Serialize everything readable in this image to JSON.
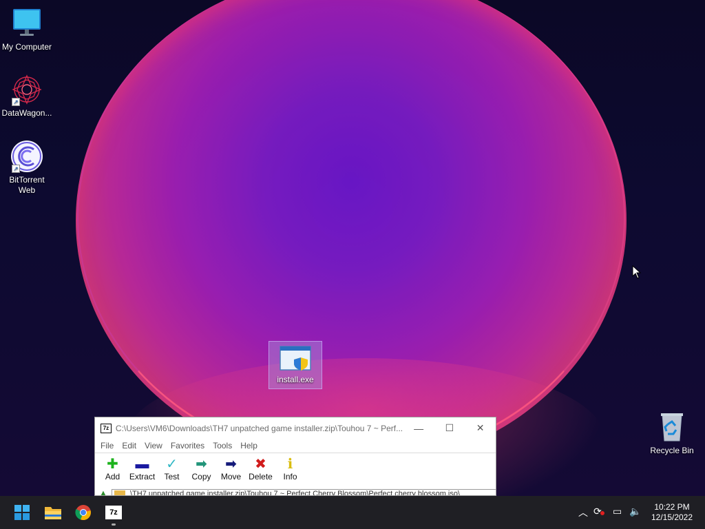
{
  "desktop": {
    "icons": [
      {
        "label": "My Computer",
        "icon": "monitor-icon"
      },
      {
        "label": "DataWagon...",
        "icon": "datawagon-icon"
      },
      {
        "label": "BitTorrent Web",
        "icon": "bittorrent-icon"
      },
      {
        "label": "install.exe",
        "icon": "installer-exe-icon"
      },
      {
        "label": "Recycle Bin",
        "icon": "recycle-bin-icon"
      }
    ]
  },
  "zip_window": {
    "app_icon_text": "7z",
    "title": "C:\\Users\\VM6\\Downloads\\TH7 unpatched game installer.zip\\Touhou 7 ~ Perf...",
    "menu": [
      "File",
      "Edit",
      "View",
      "Favorites",
      "Tools",
      "Help"
    ],
    "toolbar": [
      {
        "label": "Add",
        "icon": "plus-icon",
        "color": "#1db31d"
      },
      {
        "label": "Extract",
        "icon": "minus-icon",
        "color": "#1a1aa0"
      },
      {
        "label": "Test",
        "icon": "check-icon",
        "color": "#2fb7c4"
      },
      {
        "label": "Copy",
        "icon": "copy-arrow-icon",
        "color": "#23957a"
      },
      {
        "label": "Move",
        "icon": "move-arrow-icon",
        "color": "#151b7a"
      },
      {
        "label": "Delete",
        "icon": "delete-x-icon",
        "color": "#d11c1c"
      },
      {
        "label": "Info",
        "icon": "info-icon",
        "color": "#e0c419"
      }
    ],
    "address": "\\TH7 unpatched game installer.zip\\Touhou 7 ~ Perfect Cherry Blossom\\Perfect cherry blossom.iso\\"
  },
  "taskbar": {
    "time": "10:22 PM",
    "date": "12/15/2022",
    "zip_label": "7z"
  },
  "colors": {
    "accent": "#0078d4",
    "taskbar": "#1f1f24"
  }
}
